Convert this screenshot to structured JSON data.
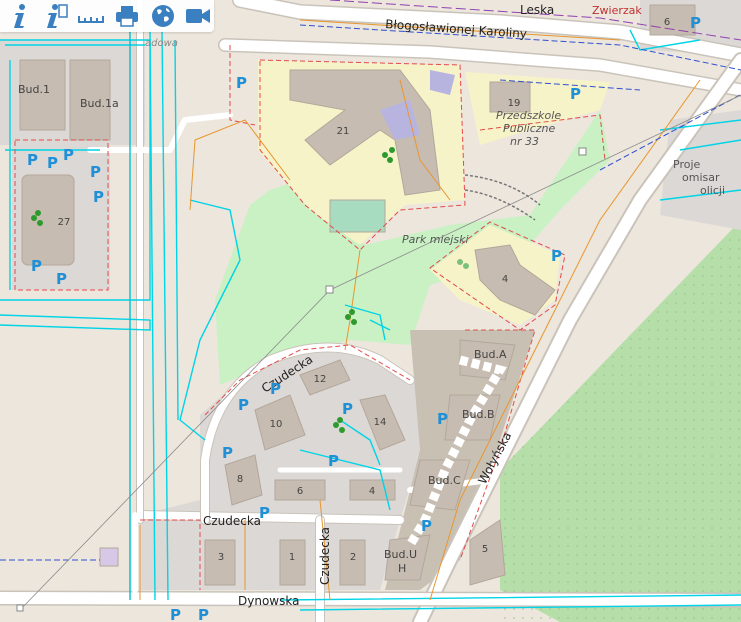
{
  "toolbar": {
    "tools": [
      "info-icon",
      "info-query-icon",
      "measure-icon",
      "print-icon",
      "globe-icon",
      "video-icon"
    ]
  },
  "colors": {
    "background": "#ece6dd",
    "park": "#c8f0c0",
    "school": "#f8f4c8",
    "building": "#c8bcb0",
    "residential": "#dcd8d4",
    "allotments": "#b8e0b0",
    "utility_cyan": "#00d8e8",
    "boundary_red": "#e04040",
    "road_white": "#ffffff",
    "parking_blue": "#1f8fd6",
    "district_purple": "#8040a0"
  },
  "map": {
    "streets": {
      "leska": "Leska",
      "zwierzak": "Zwierzak",
      "blogoslawionej": "Błogosławionej Karoliny",
      "czudecka_1": "Czudecka",
      "czudecka_2": "Czudecka",
      "czudecka_3": "Czudecka",
      "wolynska": "Wołyńska",
      "dynowska": "Dynowska",
      "sadowa": "adowa"
    },
    "labels": {
      "park": "Park miejski",
      "school_name": "Przedszkole",
      "school_line2": "Publiczne",
      "school_line3": "nr 33",
      "project_line1": "Proje",
      "project_line2": "omisar",
      "project_line3": "olicji"
    },
    "house_numbers": {
      "n19": "19",
      "n21": "21",
      "n27": "27",
      "n4": "4",
      "n12": "12",
      "n10": "10",
      "n14": "14",
      "n8": "8",
      "n6": "6",
      "n4b": "4",
      "n3": "3",
      "n1": "1",
      "n2": "2",
      "n5": "5",
      "n6b": "6"
    },
    "buildings": {
      "bud_a": "Bud.A",
      "bud_b": "Bud.B",
      "bud_c": "Bud.C",
      "bud_u": "Bud.U",
      "bud_h": "H",
      "bud_1": "Bud.1",
      "bud_1a": "Bud.1a"
    },
    "parking": "P"
  }
}
